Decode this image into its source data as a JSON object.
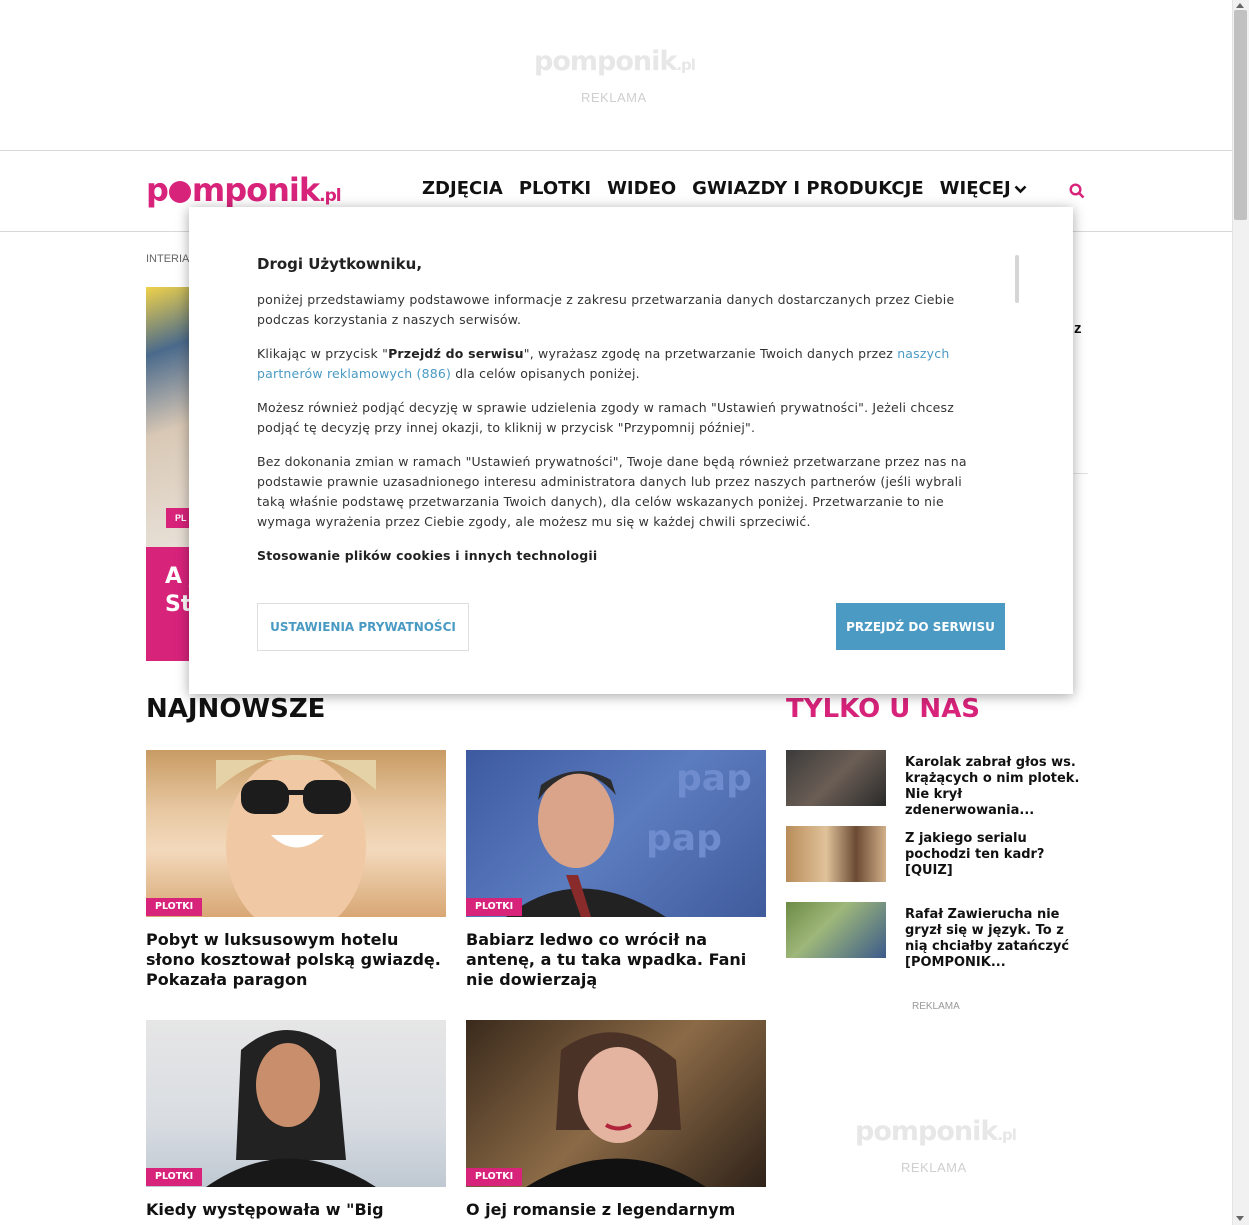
{
  "ad_top": {
    "logo": "pomponik",
    "logo_suffix": ".pl",
    "label": "REKLAMA"
  },
  "header": {
    "logo_p": "p",
    "logo_rest": "mponik",
    "logo_suffix": ".pl",
    "nav": [
      "ZDJĘCIA",
      "PLOTKI",
      "WIDEO",
      "GWIAZDY I PRODUKCJE",
      "WIĘCEJ"
    ],
    "search_icon": "search-icon"
  },
  "breadcrumb": "INTERIA",
  "hero": {
    "badge": "PL",
    "text_line1": "A j",
    "text_line2": "St"
  },
  "side_letter": "z",
  "modal": {
    "title": "Drogi Użytkowniku,",
    "p1": "poniżej przedstawiamy podstawowe informacje z zakresu przetwarzania danych dostarczanych przez Ciebie podczas korzystania z naszych serwisów.",
    "p2_a": "Klikając w przycisk \"",
    "p2_bold": "Przejdź do serwisu",
    "p2_b": "\", wyrażasz zgodę na przetwarzanie Twoich danych przez ",
    "p2_link": "naszych partnerów reklamowych (886)",
    "p2_c": " dla celów opisanych poniżej.",
    "p3": "Możesz również podjąć decyzję w sprawie udzielenia zgody w ramach \"Ustawień prywatności\". Jeżeli chcesz podjąć tę decyzję przy innej okazji, to kliknij w przycisk \"Przypomnij później\".",
    "p4": "Bez dokonania zmian w ramach \"Ustawień prywatności\", Twoje dane będą również przetwarzane przez nas na podstawie prawnie uzasadnionego interesu administratora danych lub przez naszych partnerów (jeśli wybrali taką właśnie podstawę przetwarzania Twoich danych), dla celów wskazanych poniżej. Przetwarzanie to nie wymaga wyrażenia przez Ciebie zgody, ale możesz mu się w każdej chwili sprzeciwić.",
    "p5": "Stosowanie plików cookies i innych technologii",
    "btn_settings": "USTAWIENIA PRYWATNOŚCI",
    "btn_go": "PRZEJDŹ DO SERWISU",
    "colors": {
      "accent": "#4a9ac4",
      "brand": "#d8237b"
    }
  },
  "najnowsze": {
    "title": "NAJNOWSZE",
    "cards": [
      {
        "badge": "PLOTKI",
        "title": "Pobyt w luksusowym hotelu słono kosztował polską gwiazdę. Pokazała paragon"
      },
      {
        "badge": "PLOTKI",
        "title": "Babiarz ledwo co wrócił na antenę, a tu taka wpadka. Fani nie dowierzają"
      },
      {
        "badge": "PLOTKI",
        "title": "Kiedy występowała w \"Big"
      },
      {
        "badge": "PLOTKI",
        "title": "O jej romansie z legendarnym"
      }
    ]
  },
  "tylko": {
    "title": "TYLKO U NAS",
    "items": [
      {
        "title": "Karolak zabrał głos ws. krążących o nim plotek. Nie krył zdenerwowania..."
      },
      {
        "title": "Z jakiego serialu pochodzi ten kadr? [QUIZ]"
      },
      {
        "title": "Rafał Zawierucha nie gryzł się w język. To z nią chciałby zatańczyć [POMPONIK..."
      }
    ],
    "reklama_label": "REKLAMA",
    "ad_logo": "pomponik",
    "ad_logo_suffix": ".pl",
    "ad_label": "REKLAMA"
  }
}
